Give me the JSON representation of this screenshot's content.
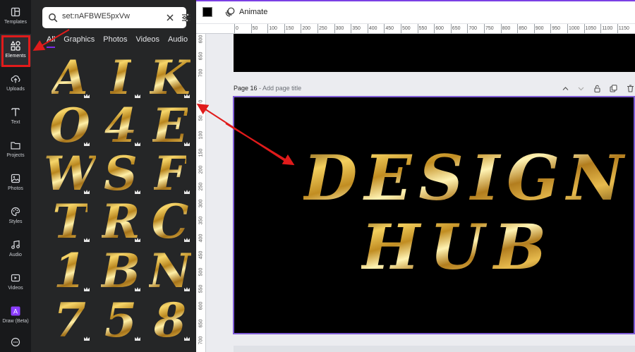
{
  "rail": {
    "items": [
      {
        "label": "Templates",
        "icon": "templates-icon"
      },
      {
        "label": "Elements",
        "icon": "elements-icon"
      },
      {
        "label": "Uploads",
        "icon": "uploads-icon"
      },
      {
        "label": "Text",
        "icon": "text-icon"
      },
      {
        "label": "Projects",
        "icon": "projects-icon"
      },
      {
        "label": "Photos",
        "icon": "photos-icon"
      },
      {
        "label": "Styles",
        "icon": "styles-icon"
      },
      {
        "label": "Audio",
        "icon": "audio-icon"
      },
      {
        "label": "Videos",
        "icon": "videos-icon"
      },
      {
        "label": "Draw (Beta)",
        "icon": "draw-icon"
      }
    ]
  },
  "search": {
    "value": "set:nAFBWE5pxVw"
  },
  "tabs": [
    "All",
    "Graphics",
    "Photos",
    "Videos",
    "Audio"
  ],
  "letters": [
    "A",
    "I",
    "K",
    "O",
    "4",
    "E",
    "W",
    "S",
    "F",
    "T",
    "R",
    "C",
    "1",
    "B",
    "N",
    "7",
    "5",
    "8"
  ],
  "toolbar": {
    "animate_label": "Animate",
    "color": "#000000"
  },
  "ruler": {
    "h": [
      "0",
      "50",
      "100",
      "150",
      "200",
      "250",
      "300",
      "350",
      "400",
      "450",
      "500",
      "550",
      "600",
      "650",
      "700",
      "750",
      "800",
      "850",
      "900",
      "950",
      "1000",
      "1050",
      "1100",
      "1150"
    ],
    "v_top": [
      "600",
      "650",
      "700"
    ],
    "v": [
      "0",
      "50",
      "100",
      "150",
      "200",
      "250",
      "300",
      "350",
      "400",
      "450",
      "500",
      "550",
      "600",
      "650",
      "700"
    ]
  },
  "page": {
    "label": "Page 16",
    "title_placeholder": "Add page title",
    "line1": "DESIGN",
    "line2": "HUB"
  },
  "colors": {
    "accent": "#7d2ae8",
    "annotation": "#e01b1b",
    "page_border": "#7f5cd6"
  }
}
